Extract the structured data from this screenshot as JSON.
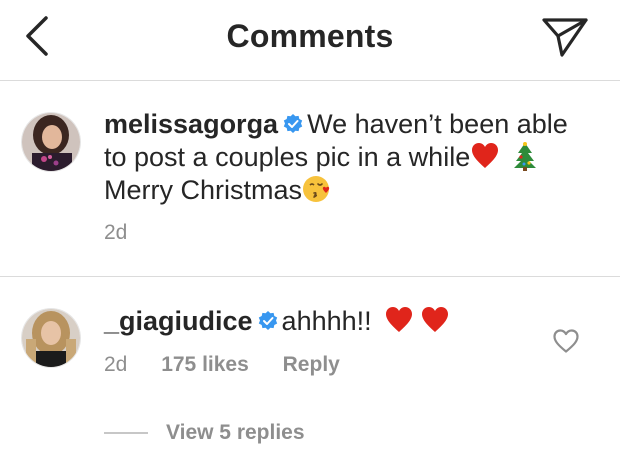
{
  "header": {
    "title": "Comments",
    "back_icon": "chevron-left-icon",
    "send_icon": "paper-plane-icon"
  },
  "comments": [
    {
      "username": "melissagorga",
      "verified": true,
      "text_line1": "We haven’t been able",
      "text_line2": "to post a couples pic in a while",
      "text_line3": "Merry Christmas",
      "time": "2d"
    },
    {
      "username": "_giagiudice",
      "verified": true,
      "text": "ahhhh!!",
      "time": "2d",
      "likes": "175 likes",
      "reply_label": "Reply",
      "view_replies": "View 5 replies"
    }
  ],
  "colors": {
    "verified_blue": "#3897f0",
    "heart_red": "#e0251b",
    "meta_gray": "#8e8e8e",
    "text": "#262626"
  }
}
